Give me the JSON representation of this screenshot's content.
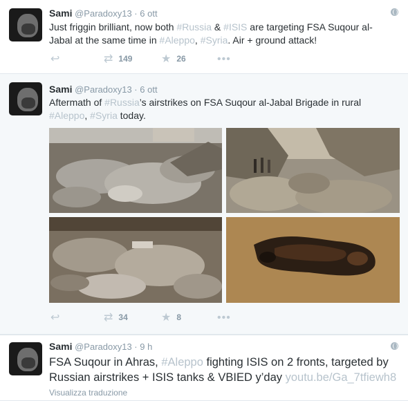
{
  "tweets": [
    {
      "name": "Sami",
      "handle": "@Paradoxy13",
      "separator": "·",
      "time": "6 ott",
      "text": [
        {
          "t": "Just friggin brilliant, now both "
        },
        {
          "t": "#Russia",
          "tag": true
        },
        {
          "t": " & "
        },
        {
          "t": "#ISIS",
          "tag": true
        },
        {
          "t": " are targeting FSA Suqour al-Jabal at the same time in "
        },
        {
          "t": "#Aleppo",
          "tag": true
        },
        {
          "t": ", "
        },
        {
          "t": "#Syria",
          "tag": true
        },
        {
          "t": ". Air + ground attack!"
        }
      ],
      "retweets": "149",
      "favorites": "26"
    },
    {
      "name": "Sami",
      "handle": "@Paradoxy13",
      "separator": "·",
      "time": "6 ott",
      "text": [
        {
          "t": "Aftermath of "
        },
        {
          "t": "#Russia",
          "tag": true
        },
        {
          "t": "’s airstrikes on FSA Suqour al-Jabal Brigade in rural "
        },
        {
          "t": "#Aleppo",
          "tag": true
        },
        {
          "t": ", "
        },
        {
          "t": "#Syria",
          "tag": true
        },
        {
          "t": " today."
        }
      ],
      "retweets": "34",
      "favorites": "8"
    },
    {
      "name": "Sami",
      "handle": "@Paradoxy13",
      "separator": "·",
      "time": "9 h",
      "text": [
        {
          "t": "FSA Suqour in Ahras, "
        },
        {
          "t": "#Aleppo",
          "tag": true
        },
        {
          "t": " fighting ISIS on 2 fronts, targeted by Russian airstrikes + ISIS tanks & VBIED y’day "
        },
        {
          "t": "youtu.be/Ga_7tfiewh8",
          "link": true
        }
      ],
      "translate_label": "Visualizza traduzione"
    }
  ],
  "icons": {
    "reply": "reply-icon",
    "retweet": "retweet-icon",
    "favorite": "star-icon",
    "more": "more-icon",
    "globe": "globe-icon"
  },
  "colors": {
    "hashtag": "#b7c3cc",
    "meta": "#8899a6",
    "text": "#292f33",
    "alt_background": "#f5f8fa"
  }
}
